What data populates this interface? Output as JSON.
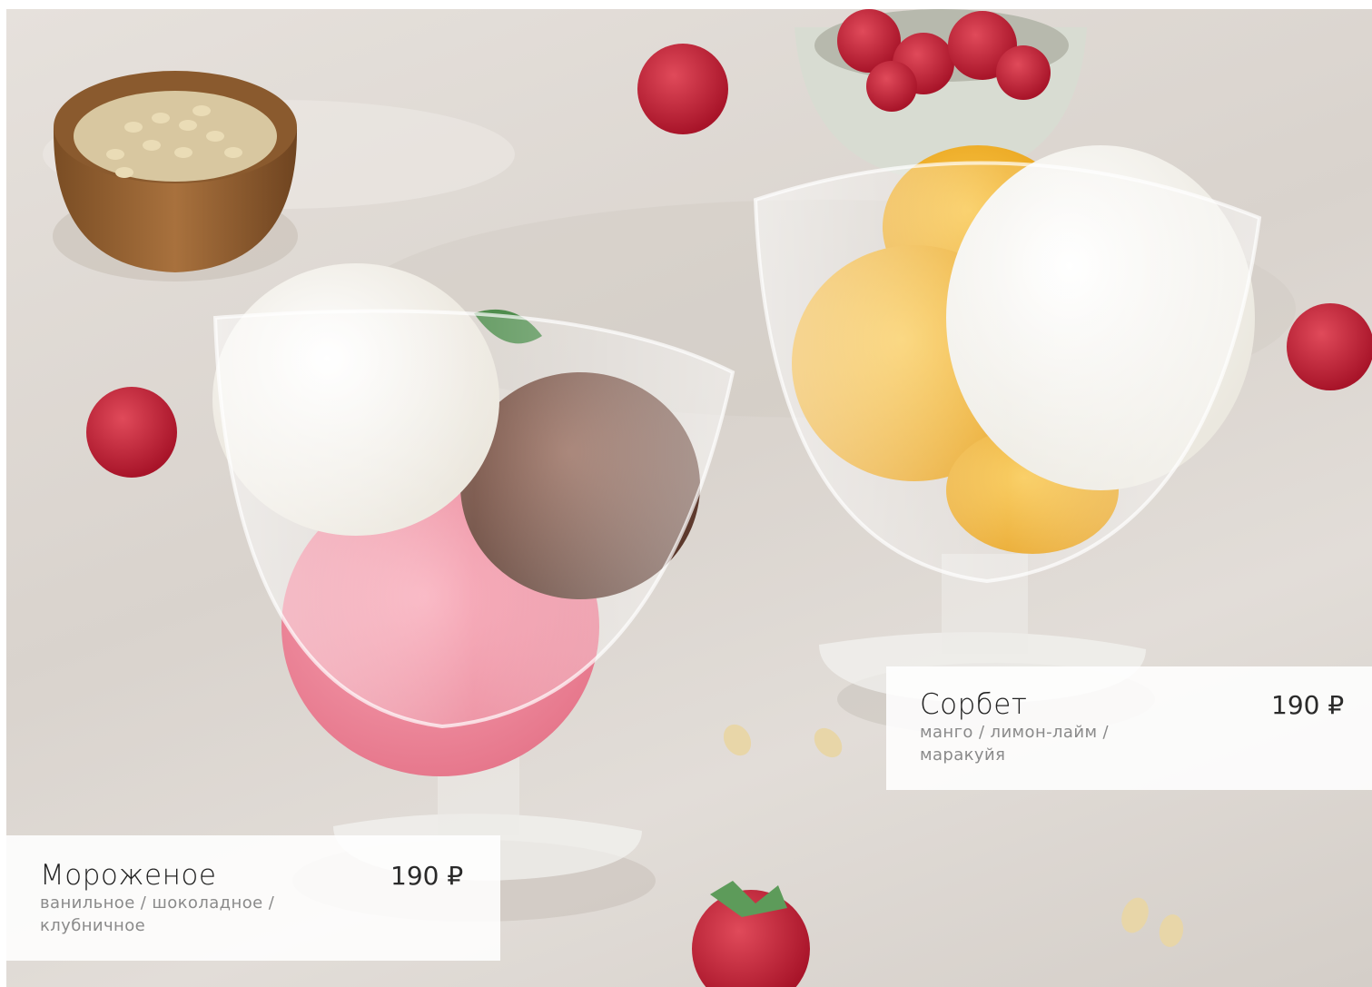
{
  "items": [
    {
      "name": "Мороженое",
      "price": "190 ₽",
      "description": "ванильное / шоколадное / клубничное"
    },
    {
      "name": "Сорбет",
      "price": "190 ₽",
      "description": "манго / лимон-лайм / маракуйя"
    }
  ],
  "colors": {
    "card_background": "#ffffff",
    "name_text": "#222222",
    "description_text": "#8a8a8a",
    "vanilla": "#f6f3ec",
    "chocolate": "#6e4638",
    "strawberry": "#ef8fa2",
    "mango": "#f3b428",
    "raspberry": "#c8213a"
  }
}
